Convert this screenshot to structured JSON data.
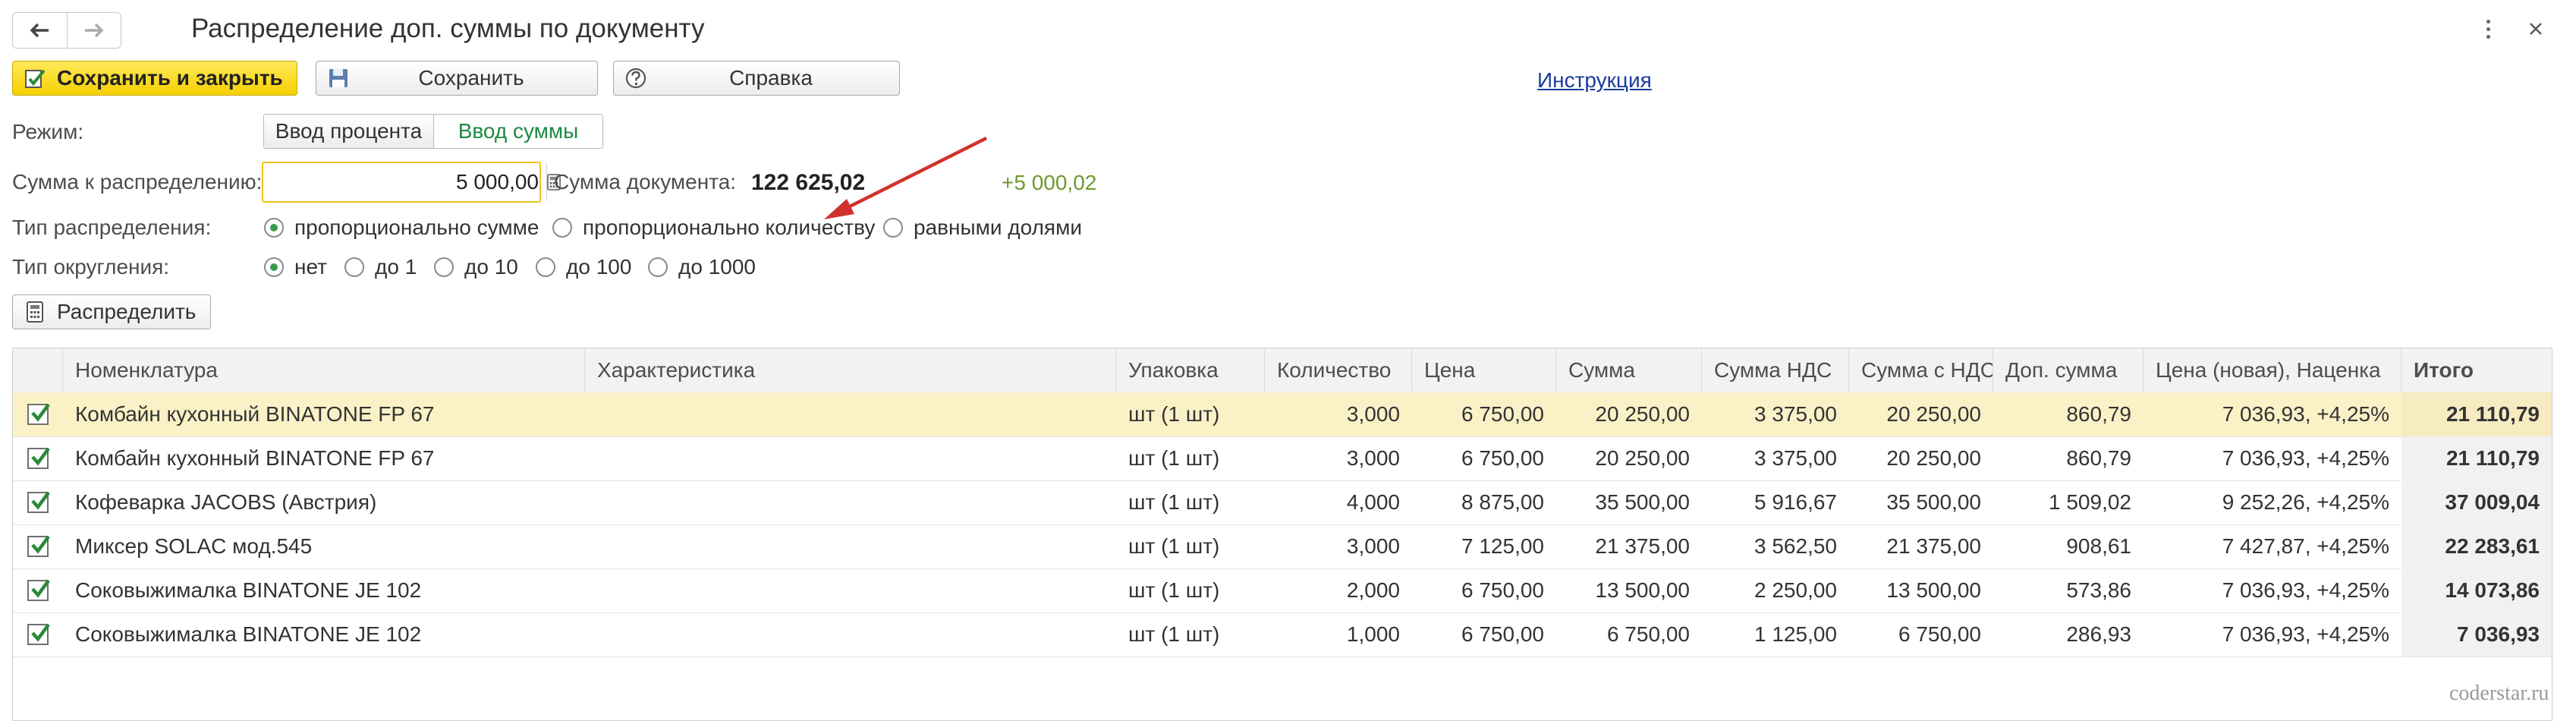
{
  "window": {
    "title": "Распределение доп. суммы по документу",
    "icons": [
      "arrow-left-icon",
      "arrow-right-icon",
      "more-vertical-icon",
      "close-icon"
    ]
  },
  "toolbar": {
    "save_close_label": "Сохранить и закрыть",
    "save_label": "Сохранить",
    "help_label": "Справка",
    "instruction_link": "Инструкция"
  },
  "form": {
    "mode_label": "Режим:",
    "mode_options": [
      "Ввод процента",
      "Ввод суммы"
    ],
    "mode_selected": "Ввод суммы",
    "sum_label": "Сумма к распределению:",
    "sum_value": "5 000,00",
    "doc_sum_label": "Сумма документа:",
    "doc_sum_value": "122 625,02",
    "delta_value": "+5 000,02",
    "distribution_label": "Тип распределения:",
    "distribution_options": [
      "пропорционально сумме",
      "пропорционально количеству",
      "равными долями"
    ],
    "distribution_selected": "пропорционально сумме",
    "rounding_label": "Тип округления:",
    "rounding_options": [
      "нет",
      "до 1",
      "до 10",
      "до 100",
      "до 1000"
    ],
    "rounding_selected": "нет",
    "distribute_button": "Распределить"
  },
  "table": {
    "columns": [
      "",
      "Номенклатура",
      "Характеристика",
      "Упаковка",
      "Количество",
      "Цена",
      "Сумма",
      "Сумма НДС",
      "Сумма с НДС",
      "Доп. сумма",
      "Цена (новая), Наценка",
      "Итого"
    ],
    "rows": [
      {
        "checked": true,
        "cells": [
          "Комбайн кухонный BINATONE FP 67",
          "",
          "шт (1 шт)",
          "3,000",
          "6 750,00",
          "20 250,00",
          "3 375,00",
          "20 250,00",
          "860,79",
          "7 036,93, +4,25%",
          "21 110,79"
        ]
      },
      {
        "checked": true,
        "cells": [
          "Комбайн кухонный BINATONE FP 67",
          "",
          "шт (1 шт)",
          "3,000",
          "6 750,00",
          "20 250,00",
          "3 375,00",
          "20 250,00",
          "860,79",
          "7 036,93, +4,25%",
          "21 110,79"
        ]
      },
      {
        "checked": true,
        "cells": [
          "Кофеварка JACOBS (Австрия)",
          "",
          "шт (1 шт)",
          "4,000",
          "8 875,00",
          "35 500,00",
          "5 916,67",
          "35 500,00",
          "1 509,02",
          "9 252,26, +4,25%",
          "37 009,04"
        ]
      },
      {
        "checked": true,
        "cells": [
          "Миксер SOLAC мод.545",
          "",
          "шт (1 шт)",
          "3,000",
          "7 125,00",
          "21 375,00",
          "3 562,50",
          "21 375,00",
          "908,61",
          "7 427,87, +4,25%",
          "22 283,61"
        ]
      },
      {
        "checked": true,
        "cells": [
          "Соковыжималка  BINATONE JE 102",
          "",
          "шт (1 шт)",
          "2,000",
          "6 750,00",
          "13 500,00",
          "2 250,00",
          "13 500,00",
          "573,86",
          "7 036,93, +4,25%",
          "14 073,86"
        ]
      },
      {
        "checked": true,
        "cells": [
          "Соковыжималка  BINATONE JE 102",
          "",
          "шт (1 шт)",
          "1,000",
          "6 750,00",
          "6 750,00",
          "1 125,00",
          "6 750,00",
          "286,93",
          "7 036,93, +4,25%",
          "7 036,93"
        ]
      }
    ],
    "selected_row": 0
  },
  "watermark": "coderstar.ru",
  "colors": {
    "primary_button": "#f5d000",
    "selected_mode": "#1e8a43",
    "selected_row": "#fbf1c7",
    "delta": "#6d9a2d",
    "link": "#1a3b9c",
    "annotation_arrow": "#d0312d"
  }
}
